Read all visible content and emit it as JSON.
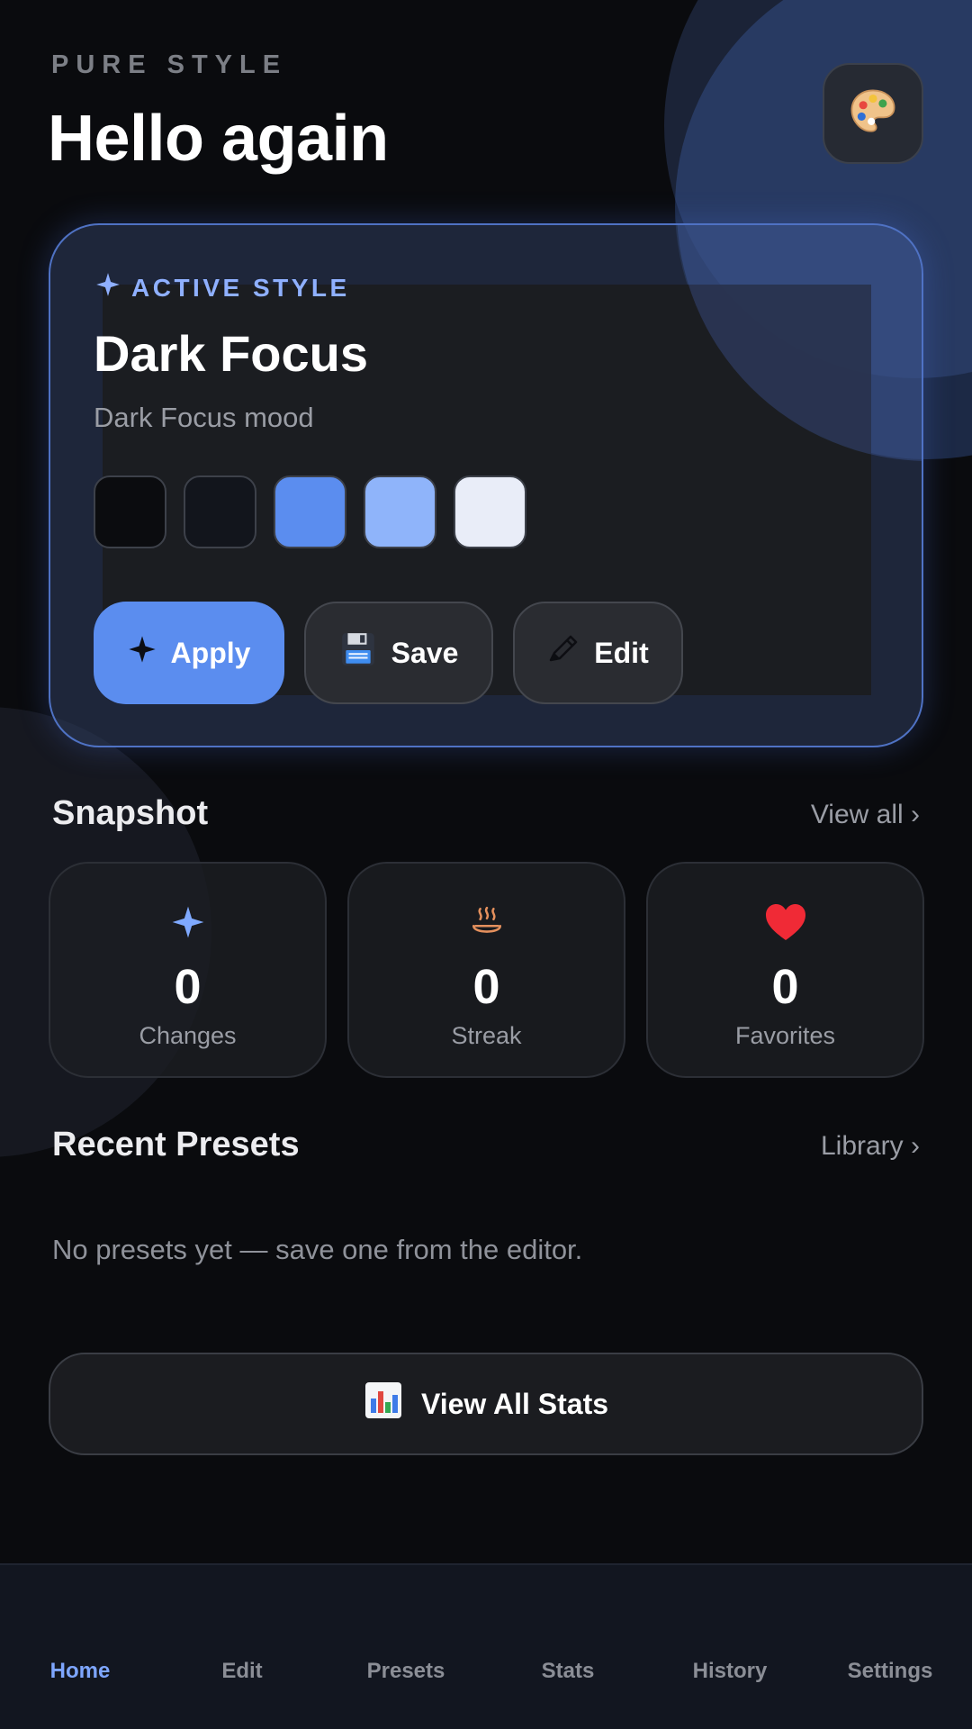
{
  "header": {
    "eyebrow": "PURE STYLE",
    "greeting": "Hello again",
    "palette_icon": "palette-icon"
  },
  "active_style": {
    "label": "ACTIVE STYLE",
    "name": "Dark Focus",
    "mood": "Dark Focus mood",
    "swatches": [
      "#0b0c0f",
      "#12151c",
      "#5b8def",
      "#8fb4fa",
      "#e9edf8"
    ],
    "actions": {
      "apply_label": "Apply",
      "save_label": "Save",
      "edit_label": "Edit"
    }
  },
  "snapshot": {
    "title": "Snapshot",
    "link": "View all ›",
    "stats": [
      {
        "icon": "sparkle-icon",
        "value": "0",
        "label": "Changes"
      },
      {
        "icon": "steam-icon",
        "value": "0",
        "label": "Streak"
      },
      {
        "icon": "heart-icon",
        "value": "0",
        "label": "Favorites"
      }
    ]
  },
  "recent_presets": {
    "title": "Recent Presets",
    "link": "Library ›",
    "empty_text": "No presets yet — save one from the editor."
  },
  "stats_button": {
    "label": "View All Stats",
    "icon": "bar-chart-icon"
  },
  "nav": {
    "active": "Home",
    "items": [
      "Home",
      "Edit",
      "Presets",
      "Stats",
      "History",
      "Settings"
    ]
  },
  "colors": {
    "background": "#0a0b0e",
    "accent": "#5b8def",
    "accent_text": "#8fb0ff",
    "nav_active": "#7ea6ff"
  }
}
